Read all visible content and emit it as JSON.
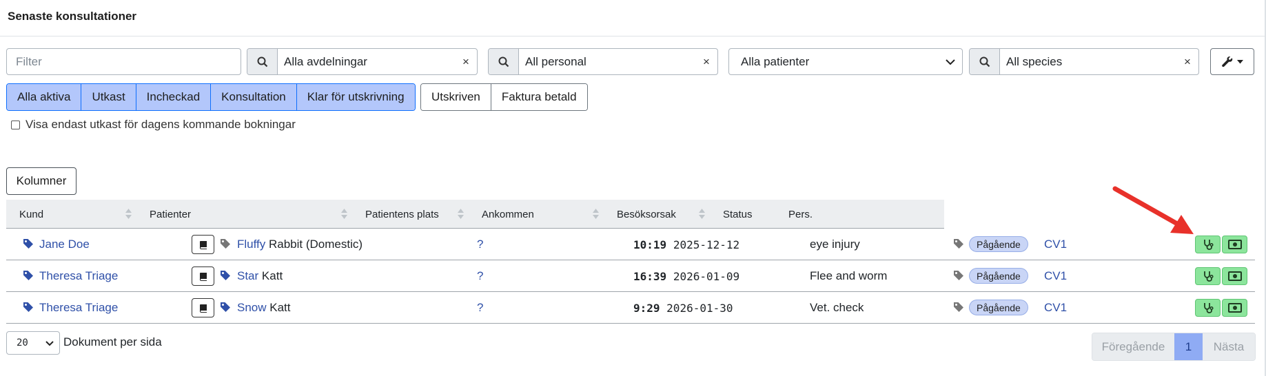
{
  "page_title": "Senaste konsultationer",
  "filters": {
    "filter_placeholder": "Filter",
    "department": {
      "value": "Alla avdelningar",
      "clear": "×"
    },
    "personnel": {
      "value": "All personal",
      "clear": "×"
    },
    "patients": {
      "value": "Alla patienter"
    },
    "species": {
      "value": "All species",
      "clear": "×"
    }
  },
  "status_buttons": {
    "active_group": [
      "Alla aktiva",
      "Utkast",
      "Incheckad",
      "Konsultation",
      "Klar för utskrivning"
    ],
    "other_group": [
      "Utskriven",
      "Faktura betald"
    ]
  },
  "draft_checkbox_label": "Visa endast utkast för dagens kommande bokningar",
  "columns_button": "Kolumner",
  "table": {
    "headers": [
      "Kund",
      "Patienter",
      "Patientens plats",
      "Ankommen",
      "Besöksorsak",
      "Status",
      "Pers."
    ],
    "rows": [
      {
        "customer": "Jane Doe",
        "patient_name": "Fluffy",
        "patient_species": "Rabbit (Domestic)",
        "location": "?",
        "arrived_time": "10:19",
        "arrived_date": "2025-12-12",
        "reason": "eye injury",
        "status": "Pågående",
        "staff": "CV1"
      },
      {
        "customer": "Theresa Triage",
        "patient_name": "Star",
        "patient_species": "Katt",
        "location": "?",
        "arrived_time": "16:39",
        "arrived_date": "2026-01-09",
        "reason": "Flee and worm",
        "status": "Pågående",
        "staff": "CV1"
      },
      {
        "customer": "Theresa Triage",
        "patient_name": "Snow",
        "patient_species": "Katt",
        "location": "?",
        "arrived_time": "9:29",
        "arrived_date": "2026-01-30",
        "reason": "Vet. check",
        "status": "Pågående",
        "staff": "CV1"
      }
    ]
  },
  "pagination": {
    "per_page_value": "20",
    "per_page_label": "Dokument per sida",
    "prev": "Föregående",
    "current": "1",
    "next": "Nästa"
  },
  "colors": {
    "accent_blue": "#b3c7fb",
    "link": "#2f50a8",
    "action_green": "#8ce59c",
    "badge": "#c9d5f6",
    "annotation_arrow": "#e8312a"
  }
}
